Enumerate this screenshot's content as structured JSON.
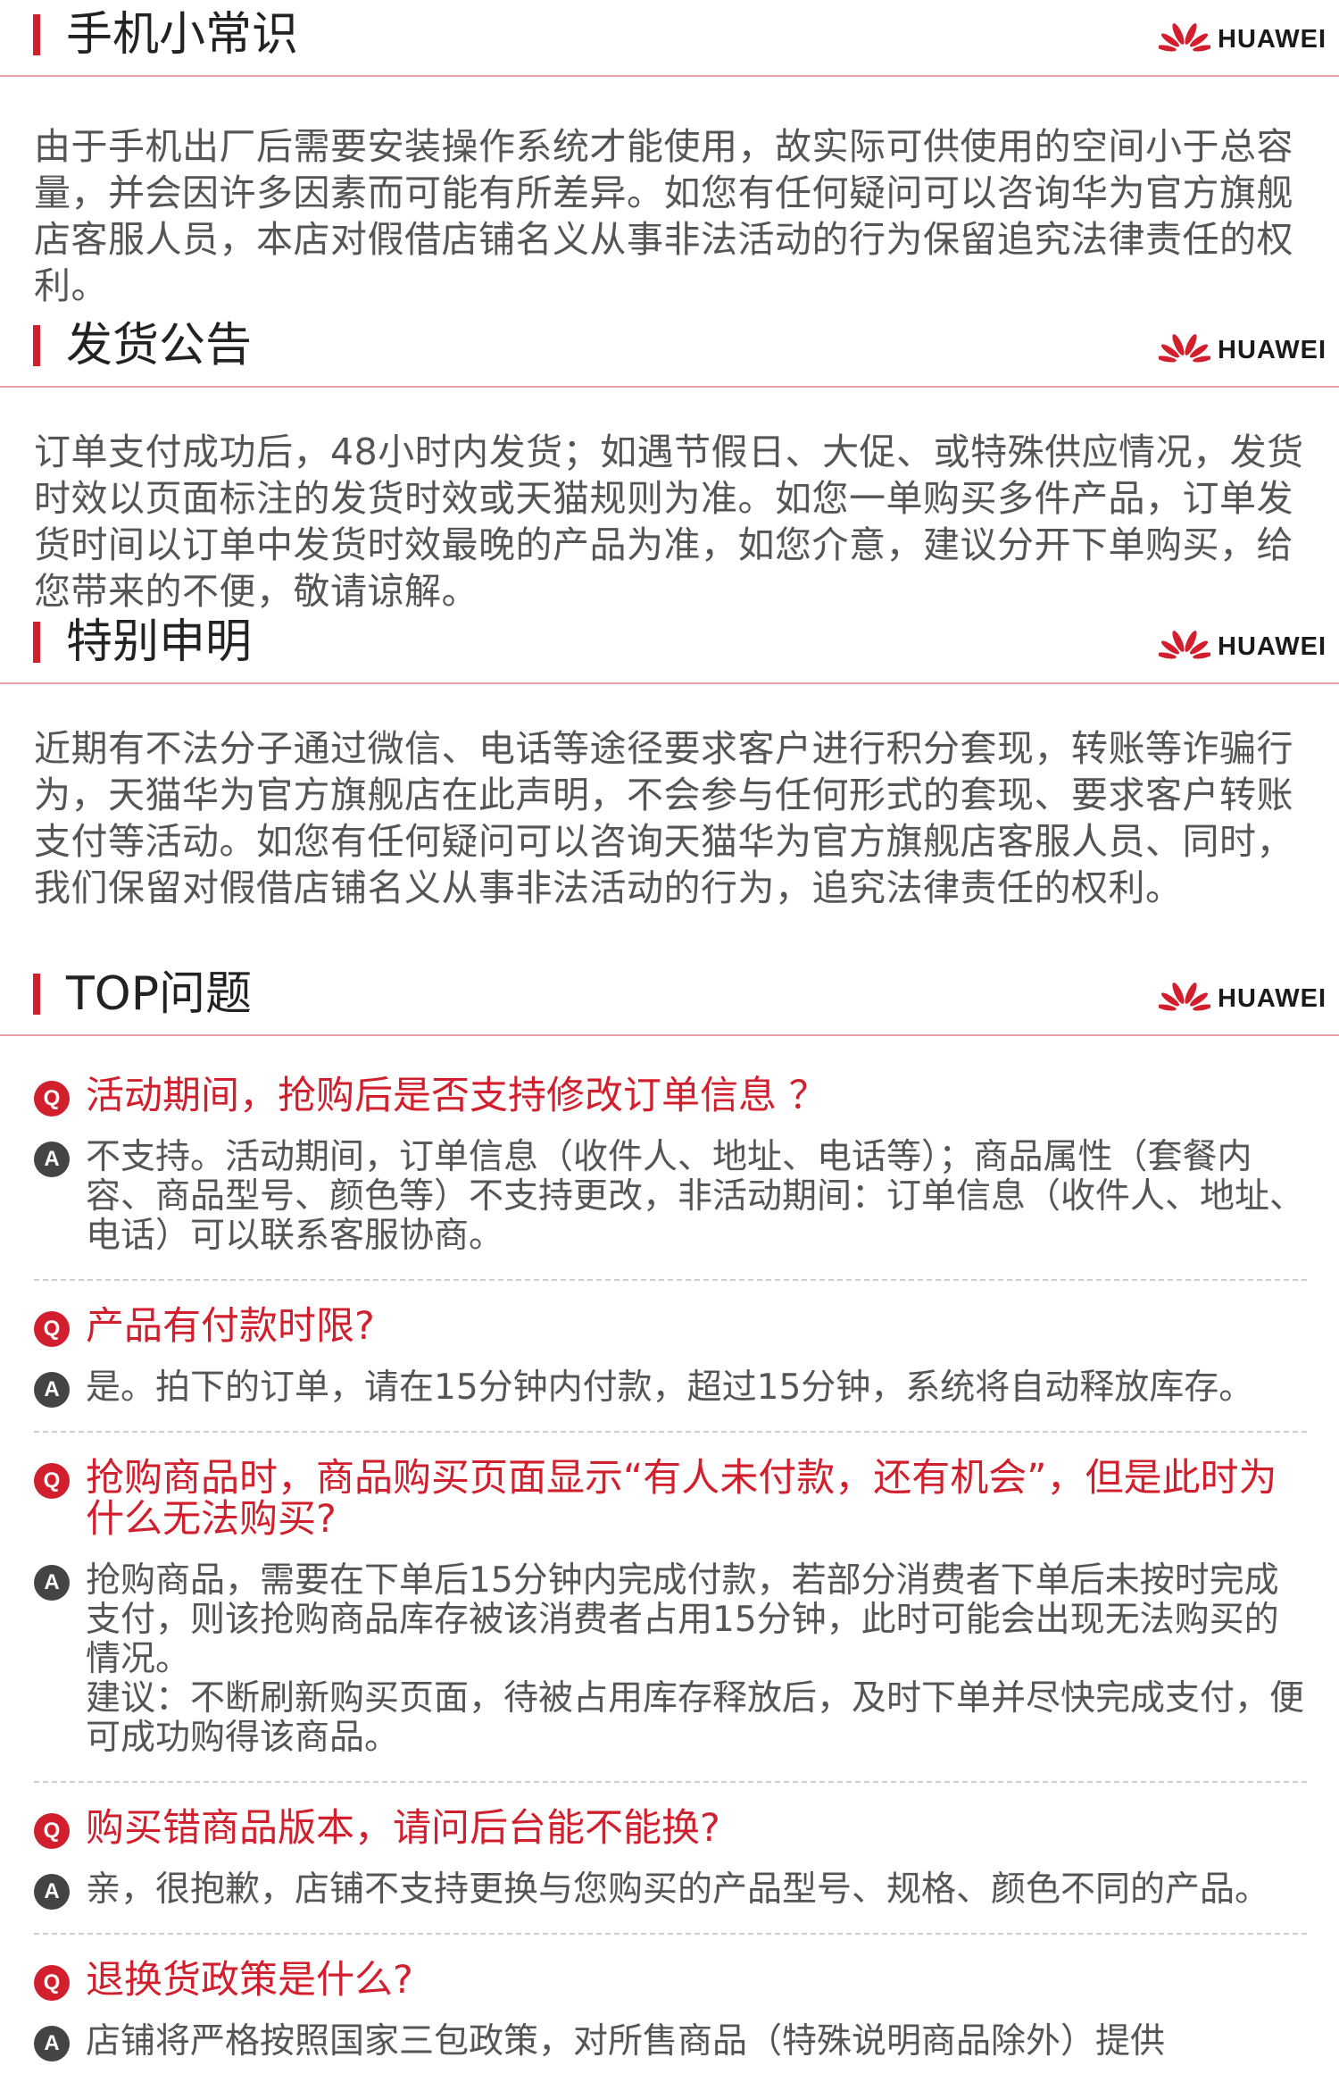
{
  "brand": {
    "name": "HUAWEI"
  },
  "colors": {
    "accent": "#d21f2d",
    "rule": "#e8a0a6",
    "body_text": "#555555",
    "heading_text": "#222222"
  },
  "sections": [
    {
      "title": "手机小常识",
      "body": "由于手机出厂后需要安装操作系统才能使用，故实际可供使用的空间小于总容量，并会因许多因素而可能有所差异。如您有任何疑问可以咨询华为官方旗舰店客服人员，本店对假借店铺名义从事非法活动的行为保留追究法律责任的权利。"
    },
    {
      "title": "发货公告",
      "body": "订单支付成功后，48小时内发货；如遇节假日、大促、或特殊供应情况，发货时效以页面标注的发货时效或天猫规则为准。如您一单购买多件产品，订单发货时间以订单中发货时效最晚的产品为准，如您介意，建议分开下单购买，给您带来的不便，敬请谅解。"
    },
    {
      "title": "特别申明",
      "body": "近期有不法分子通过微信、电话等途径要求客户进行积分套现，转账等诈骗行为，天猫华为官方旗舰店在此声明，不会参与任何形式的套现、要求客户转账支付等活动。如您有任何疑问可以咨询天猫华为官方旗舰店客服人员、同时，我们保留对假借店铺名义从事非法活动的行为，追究法律责任的权利。"
    },
    {
      "title": "TOP问题"
    }
  ],
  "faq": [
    {
      "q": "活动期间，抢购后是否支持修改订单信息 ？",
      "a": [
        "不支持。活动期间，订单信息（收件人、地址、电话等）；商品属性（套餐内容、商品型号、颜色等）不支持更改，非活动期间：订单信息（收件人、地址、电话）可以联系客服协商。"
      ]
    },
    {
      "q": "产品有付款时限?",
      "a": [
        "是。拍下的订单，请在15分钟内付款，超过15分钟，系统将自动释放库存。"
      ]
    },
    {
      "q": "抢购商品时，商品购买页面显示“有人未付款，还有机会”，但是此时为什么无法购买?",
      "a": [
        "抢购商品，需要在下单后15分钟内完成付款，若部分消费者下单后未按时完成支付，则该抢购商品库存被该消费者占用15分钟，此时可能会出现无法购买的情况。",
        "建议：不断刷新购买页面，待被占用库存释放后，及时下单并尽快完成支付，便可成功购得该商品。"
      ]
    },
    {
      "q": "购买错商品版本，请问后台能不能换?",
      "a": [
        "亲，很抱歉，店铺不支持更换与您购买的产品型号、规格、颜色不同的产品。"
      ]
    },
    {
      "q": "退换货政策是什么?",
      "a": [
        "店铺将严格按照国家三包政策，对所售商品（特殊说明商品除外）提供"
      ]
    }
  ],
  "icons": {
    "question": "Q",
    "answer": "A",
    "brand_logo": "huawei-petal-logo"
  }
}
